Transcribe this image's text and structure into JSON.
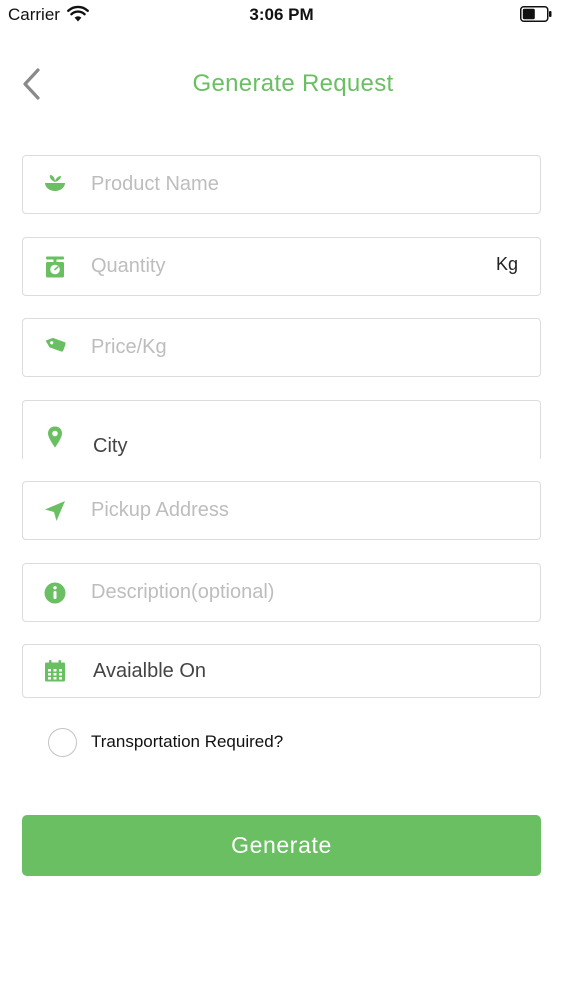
{
  "status_bar": {
    "carrier": "Carrier",
    "time": "3:06 PM"
  },
  "header": {
    "title": "Generate Request",
    "back_icon": "chevron-left-icon"
  },
  "form": {
    "product_name": {
      "placeholder": "Product Name",
      "value": "",
      "icon": "leaf-bowl-icon"
    },
    "quantity": {
      "placeholder": "Quantity",
      "value": "",
      "unit": "Kg",
      "icon": "scale-icon"
    },
    "price": {
      "placeholder": "Price/Kg",
      "value": "",
      "icon": "price-tag-icon"
    },
    "city": {
      "label": "City",
      "icon": "location-pin-icon"
    },
    "pickup_address": {
      "placeholder": "Pickup Address",
      "value": "",
      "icon": "navigation-arrow-icon"
    },
    "description": {
      "placeholder": "Description(optional)",
      "value": "",
      "icon": "info-icon"
    },
    "available_on": {
      "label": "Avaialble On",
      "icon": "calendar-icon"
    },
    "transportation": {
      "label": "Transportation Required?",
      "checked": false
    }
  },
  "actions": {
    "generate_label": "Generate"
  },
  "colors": {
    "accent": "#6abf63",
    "placeholder": "#bdbdbd",
    "border": "#dcdcdc"
  }
}
